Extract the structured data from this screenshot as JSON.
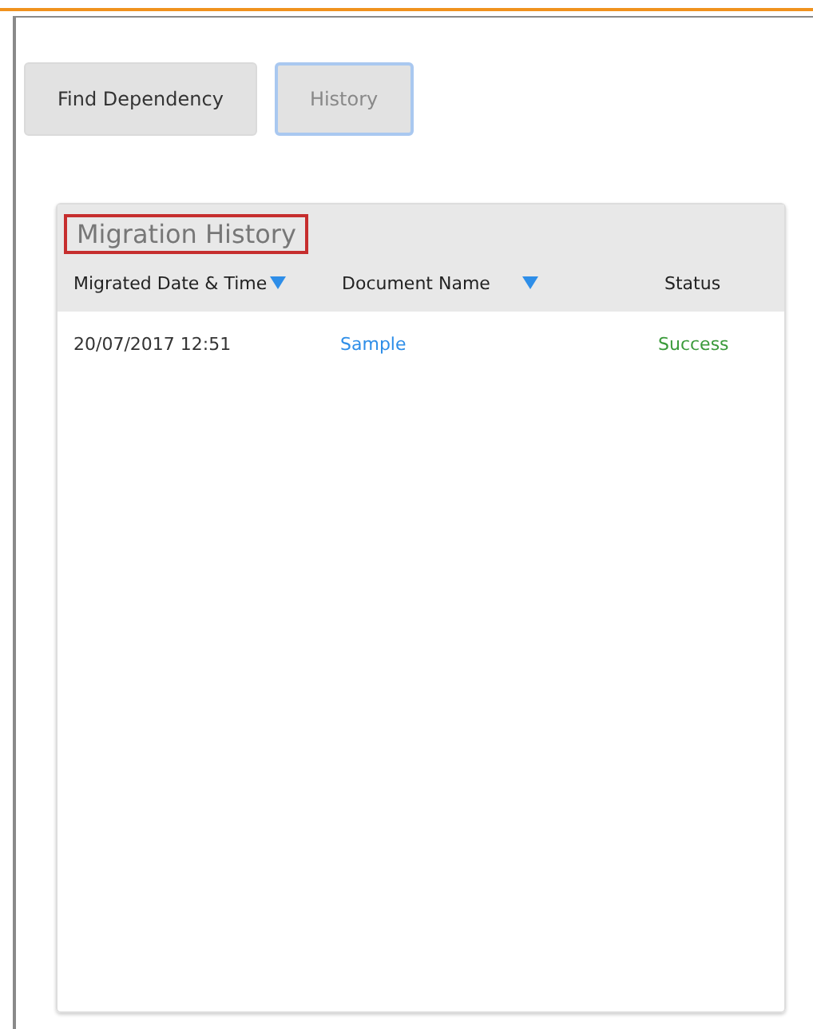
{
  "tabs": [
    {
      "label": "Find Dependency",
      "selected": false
    },
    {
      "label": "History",
      "selected": true
    }
  ],
  "panel": {
    "title": "Migration History",
    "title_highlighted": true
  },
  "table": {
    "columns": [
      {
        "label": "Migrated Date & Time",
        "sort_indicator": true
      },
      {
        "label": "Document Name",
        "sort_indicator": true
      },
      {
        "label": "Status",
        "sort_indicator": false
      }
    ],
    "rows": [
      [
        {
          "kind": "text",
          "text": "20/07/2017 12:51"
        },
        {
          "kind": "link",
          "text": "Sample"
        },
        {
          "kind": "status",
          "text": "Success"
        }
      ]
    ]
  }
}
